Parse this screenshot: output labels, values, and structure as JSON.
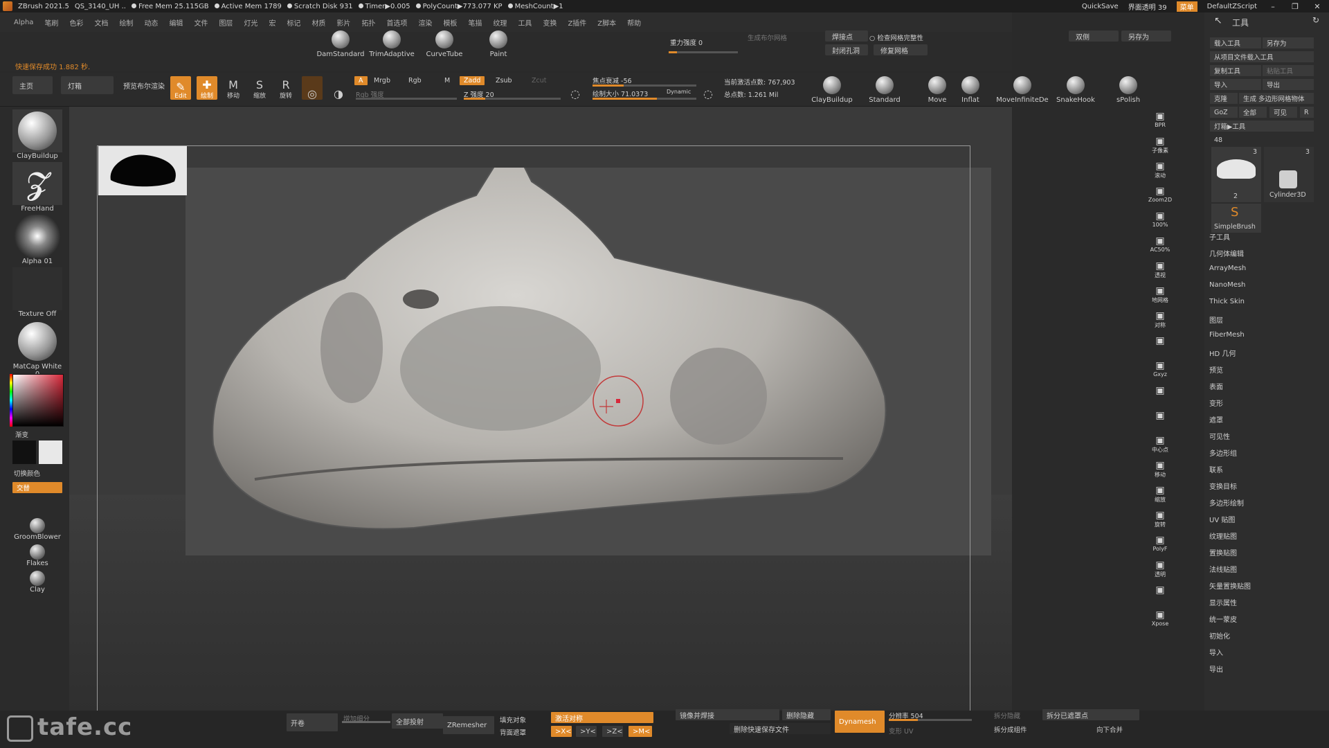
{
  "titlebar": {
    "app": "ZBrush 2021.5",
    "file": "QS_3140_UH ..",
    "free_mem": "Free Mem 25.115GB",
    "active_mem": "Active Mem 1789",
    "scratch": "Scratch Disk 931",
    "timer": "Timer▶0.005",
    "polycount": "PolyCount▶773.077 KP",
    "meshcount": "MeshCount▶1",
    "quicksave": "QuickSave",
    "transparency": "界面透明 39",
    "menu_btn": "菜单",
    "script": "DefaultZScript"
  },
  "menubar": [
    "Alpha",
    "笔刷",
    "色彩",
    "文档",
    "绘制",
    "动态",
    "编辑",
    "文件",
    "图层",
    "灯光",
    "宏",
    "标记",
    "材质",
    "影片",
    "拓扑",
    "首选项",
    "渲染",
    "模板",
    "笔描",
    "纹理",
    "工具",
    "变换",
    "Z插件",
    "Z脚本",
    "帮助"
  ],
  "notice": "快速保存成功 1.882 秒.",
  "shelf_brushes": [
    "DamStandard",
    "TrimAdaptive",
    "CurveTube",
    "Paint"
  ],
  "gravity": "重力强度 0",
  "shelf_right": {
    "gen_grid": "生成布尔网格",
    "weld": "焊接点",
    "check": "检查网格完整性",
    "close_holes": "封闭孔洞",
    "fix_mesh": "修复网格",
    "double": "双侧",
    "save_as": "另存为"
  },
  "ctrl": {
    "home": "主页",
    "lightbox": "灯箱",
    "preview_bool": "预览布尔渲染",
    "edit": "Edit",
    "draw": "绘制",
    "move": "移动",
    "scale": "缩放",
    "rotate": "旋转",
    "a": "A",
    "mrgb": "Mrgb",
    "rgb": "Rgb",
    "m": "M",
    "zadd": "Zadd",
    "zsub": "Zsub",
    "zcut": "Zcut",
    "rgb_intensity": "Rgb 强度",
    "z_intensity": "Z 强度 20",
    "focal": "焦点衰减 -56",
    "draw_size": "绘制大小 71.0373",
    "dynamic": "Dynamic",
    "active_points": "当前激活点数: 767,903",
    "total_points": "总点数: 1.261 Mil",
    "brushes": [
      "ClayBuildup",
      "Standard",
      "Move",
      "Inflat",
      "MoveInfiniteDe",
      "SnakeHook",
      "sPolish"
    ]
  },
  "left": {
    "brush": "ClayBuildup",
    "stroke": "FreeHand",
    "alpha": "Alpha 01",
    "texture": "Texture Off",
    "material": "MatCap White 0",
    "gradient": "渐变",
    "switch_color": "切换颜色",
    "alternate": "交替",
    "extra": [
      "GroomBlower",
      "Flakes",
      "Clay"
    ]
  },
  "nav": [
    "BPR",
    "子像素",
    "滚动",
    "Zoom2D",
    "100%",
    "AC50%",
    "透视",
    "地网格",
    "对称",
    "",
    "Gxyz",
    "",
    "",
    "中心点",
    "移动",
    "缩放",
    "旋转",
    "PolyF",
    "透明",
    "",
    "Xpose"
  ],
  "right": {
    "title": "工具",
    "load": "载入工具",
    "save": "另存为",
    "from_project": "从项目文件载入工具",
    "copy": "复制工具",
    "paste": "粘贴工具",
    "import": "导入",
    "export": "导出",
    "clone": "克隆",
    "gen_multi": "生成 多边形网格物体",
    "goz": "GoZ",
    "all": "全部",
    "visible": "可见",
    "r": "R",
    "lightbox_tools": "灯箱▶工具",
    "size": "48",
    "tool_a_count": "3",
    "tool_b_count": "3",
    "tool_b": "Cylinder3D",
    "tool_c": "SimpleBrush",
    "tool_a_idx": "2",
    "list": [
      "子工具",
      "几何体编辑",
      "ArrayMesh",
      "NanoMesh",
      "Thick Skin",
      "图层",
      "FiberMesh",
      "HD 几何",
      "预览",
      "表面",
      "变形",
      "遮罩",
      "可见性",
      "多边形组",
      "联系",
      "变换目标",
      "多边形绘制",
      "UV 贴图",
      "纹理贴图",
      "置换贴图",
      "法线贴图",
      "矢量置换贴图",
      "显示属性",
      "统一蒙皮",
      "初始化",
      "导入",
      "导出"
    ]
  },
  "bottom": {
    "open": "开卷",
    "z": "增加细分",
    "all_proj": "全部投射",
    "zremesher": "ZRemesher",
    "fill": "填充对象",
    "back": "背面遮罩",
    "active_sym": "激活对称",
    "x": ">X<",
    "y": ">Y<",
    "z2": ">Z<",
    "m": ">M<",
    "mirror_weld": "镜像并焊接",
    "delete_hidden": "删除隐藏",
    "del_quicksave": "删除快速保存文件",
    "dynamesh": "Dynamesh",
    "resolution": "分辨率 504",
    "uv": "变形 UV",
    "split_hidden": "拆分隐藏",
    "split_masked": "拆分已遮罩点",
    "split_groups": "拆分成组件",
    "merge_down": "向下合并"
  },
  "watermark": "tafe.cc"
}
